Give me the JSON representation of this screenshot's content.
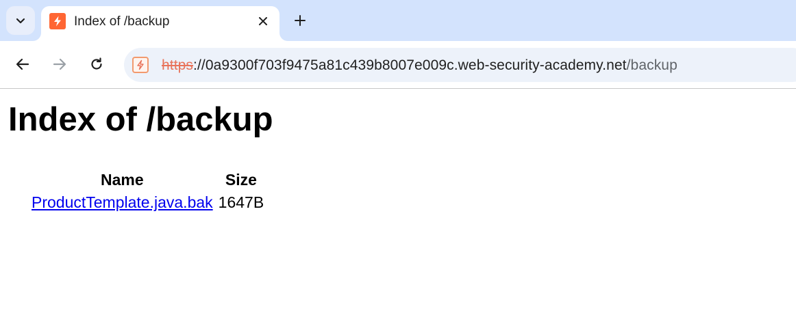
{
  "browser": {
    "tab": {
      "title": "Index of /backup"
    },
    "address_bar": {
      "scheme": "https",
      "host_part": "://0a9300f703f9475a81c439b8007e009c.web-security-academy.net",
      "path": "/backup"
    },
    "icons": {
      "tab_search": "chevron-down-icon",
      "favicon": "lightning-bolt-icon",
      "close": "close-icon",
      "new_tab": "plus-icon",
      "back": "arrow-left-icon",
      "forward": "arrow-right-icon",
      "reload": "reload-icon",
      "site_info": "not-secure-icon"
    },
    "colors": {
      "tabstrip_bg": "#d3e3fd",
      "favicon_bg": "#ff6633",
      "insecure_scheme": "#e8735a",
      "link": "#0000ee"
    }
  },
  "page": {
    "heading": "Index of /backup",
    "table": {
      "columns": [
        "Name",
        "Size"
      ],
      "rows": [
        {
          "name": "ProductTemplate.java.bak",
          "size": "1647B"
        }
      ]
    }
  }
}
